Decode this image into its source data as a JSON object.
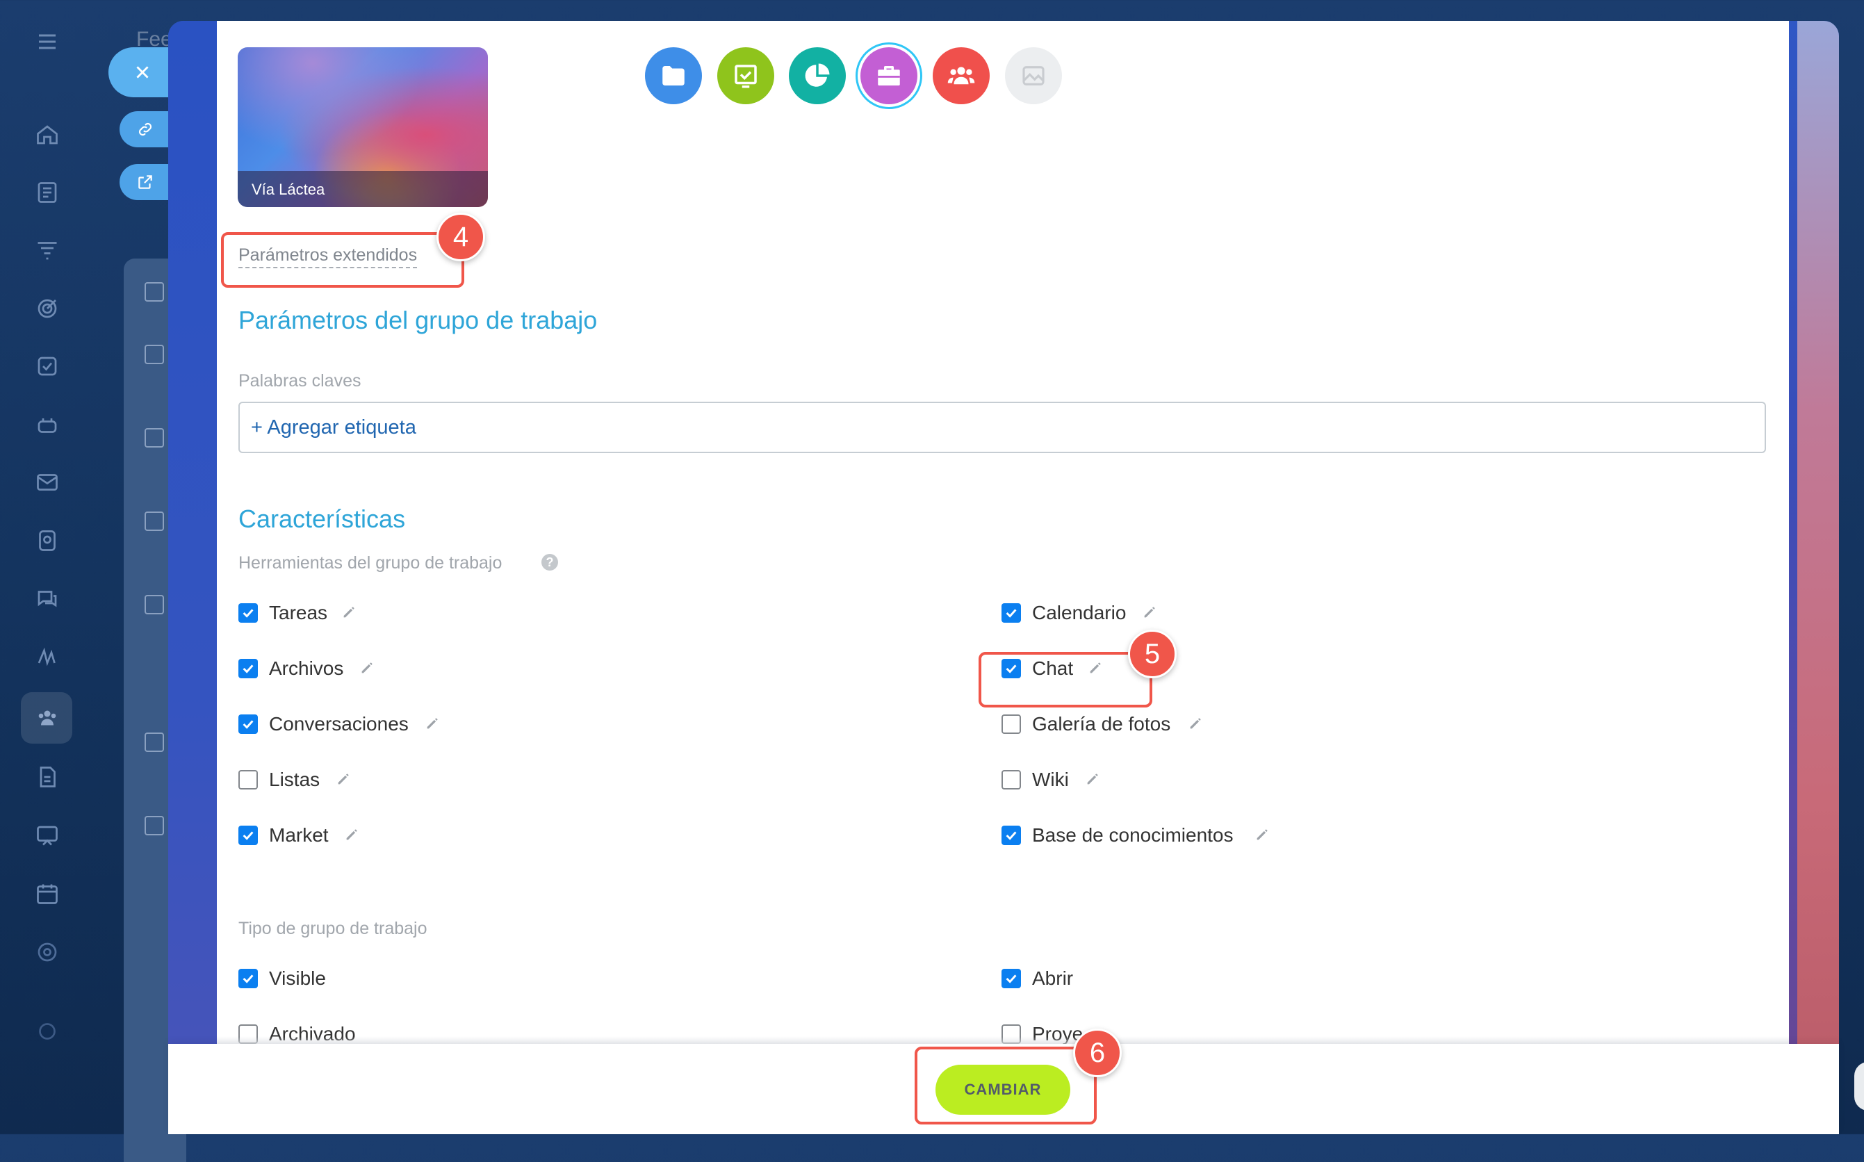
{
  "background": {
    "feed_title": "Fee"
  },
  "theme": {
    "label": "Vía Láctea"
  },
  "group_types": [
    {
      "icon": "folder-icon",
      "color": "#3e8ee8",
      "selected": false
    },
    {
      "icon": "board-check-icon",
      "color": "#8fc41c",
      "selected": false
    },
    {
      "icon": "pie-chart-icon",
      "color": "#12b1a3",
      "selected": false
    },
    {
      "icon": "briefcase-icon",
      "color": "#c35fd4",
      "selected": true
    },
    {
      "icon": "people-icon",
      "color": "#f0504c",
      "selected": false
    },
    {
      "icon": "image-icon",
      "color": "#eceef0",
      "selected": false
    }
  ],
  "advanced_link": "Parámetros extendidos",
  "workgroup_params": {
    "title": "Parámetros del grupo de trabajo",
    "keywords_label": "Palabras claves",
    "add_tag": "+ Agregar etiqueta"
  },
  "features": {
    "title": "Características",
    "tools_label": "Herramientas del grupo de trabajo",
    "help": "?",
    "left_tools": [
      {
        "label": "Tareas",
        "checked": true
      },
      {
        "label": "Archivos",
        "checked": true
      },
      {
        "label": "Conversaciones",
        "checked": true
      },
      {
        "label": "Listas",
        "checked": false
      },
      {
        "label": "Market",
        "checked": true
      }
    ],
    "right_tools": [
      {
        "label": "Calendario",
        "checked": true
      },
      {
        "label": "Chat",
        "checked": true
      },
      {
        "label": "Galería de fotos",
        "checked": false
      },
      {
        "label": "Wiki",
        "checked": false
      },
      {
        "label": "Base de conocimientos",
        "checked": true
      }
    ]
  },
  "group_type": {
    "label": "Tipo de grupo de trabajo",
    "visible": {
      "label": "Visible",
      "checked": true
    },
    "open": {
      "label": "Abrir",
      "checked": true
    },
    "archived": {
      "label": "Archivado",
      "checked": false
    },
    "project": {
      "label": "Proye",
      "checked": false
    }
  },
  "footer": {
    "submit_label": "CAMBIAR"
  },
  "annotations": {
    "step4": "4",
    "step5": "5",
    "step6": "6",
    "color": "#f0564a"
  }
}
